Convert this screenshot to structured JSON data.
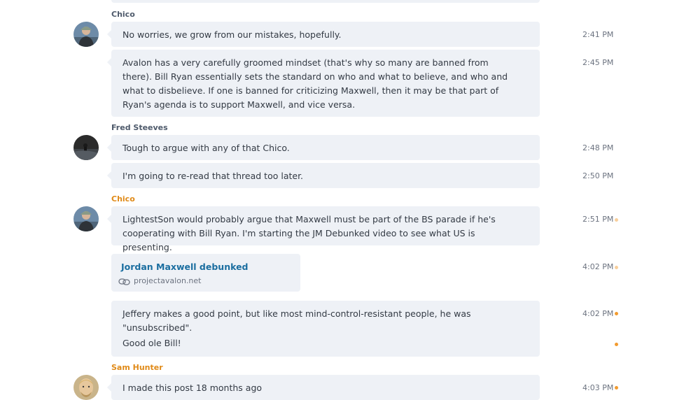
{
  "colors": {
    "bubble_bg": "#eef1f6",
    "sender_default": "#4e5a6b",
    "sender_highlight": "#e08a18",
    "link": "#1b6ea0",
    "unread_dot": "#f29b2f",
    "read_dot": "#f8cf9c"
  },
  "chat": {
    "messages": [
      {
        "sender": "Chico",
        "text": "No worries, we grow from our mistakes, hopefully.",
        "time": "2:41 PM"
      },
      {
        "text": "Avalon has a very carefully groomed mindset (that's why so many are banned from there).  Bill Ryan essentially sets the standard on who and what to believe, and who and what to disbelieve.  If one is banned for criticizing Maxwell, then it may be that part of Ryan's agenda is to support Maxwell, and vice versa.",
        "time": "2:45 PM"
      },
      {
        "sender": "Fred Steeves",
        "text": "Tough to argue with any of that Chico.",
        "time": "2:48 PM"
      },
      {
        "text": "I'm going to re-read that thread too later.",
        "time": "2:50 PM"
      },
      {
        "sender": "Chico",
        "text": "LightestSon would probably argue that Maxwell must be part of the BS parade if he's cooperating with Bill Ryan.  I'm starting the JM Debunked video to see what US is presenting.",
        "time": "2:51 PM"
      },
      {
        "link_title": "Jordan Maxwell debunked",
        "link_domain": "projectavalon.net",
        "time": "4:02 PM"
      },
      {
        "text": "Jeffery makes a good point, but like most mind-control-resistant people, he was \"unsubscribed\".",
        "text2": "Good ole Bill!",
        "time": "4:02 PM"
      },
      {
        "sender": "Sam Hunter",
        "text": "I made this post 18 months ago",
        "time": "4:03 PM"
      }
    ]
  },
  "icons": {
    "link": "link-icon",
    "avatar_chico": "avatar-chico",
    "avatar_fred": "avatar-fred-steeves",
    "avatar_sam": "avatar-sam-hunter"
  }
}
